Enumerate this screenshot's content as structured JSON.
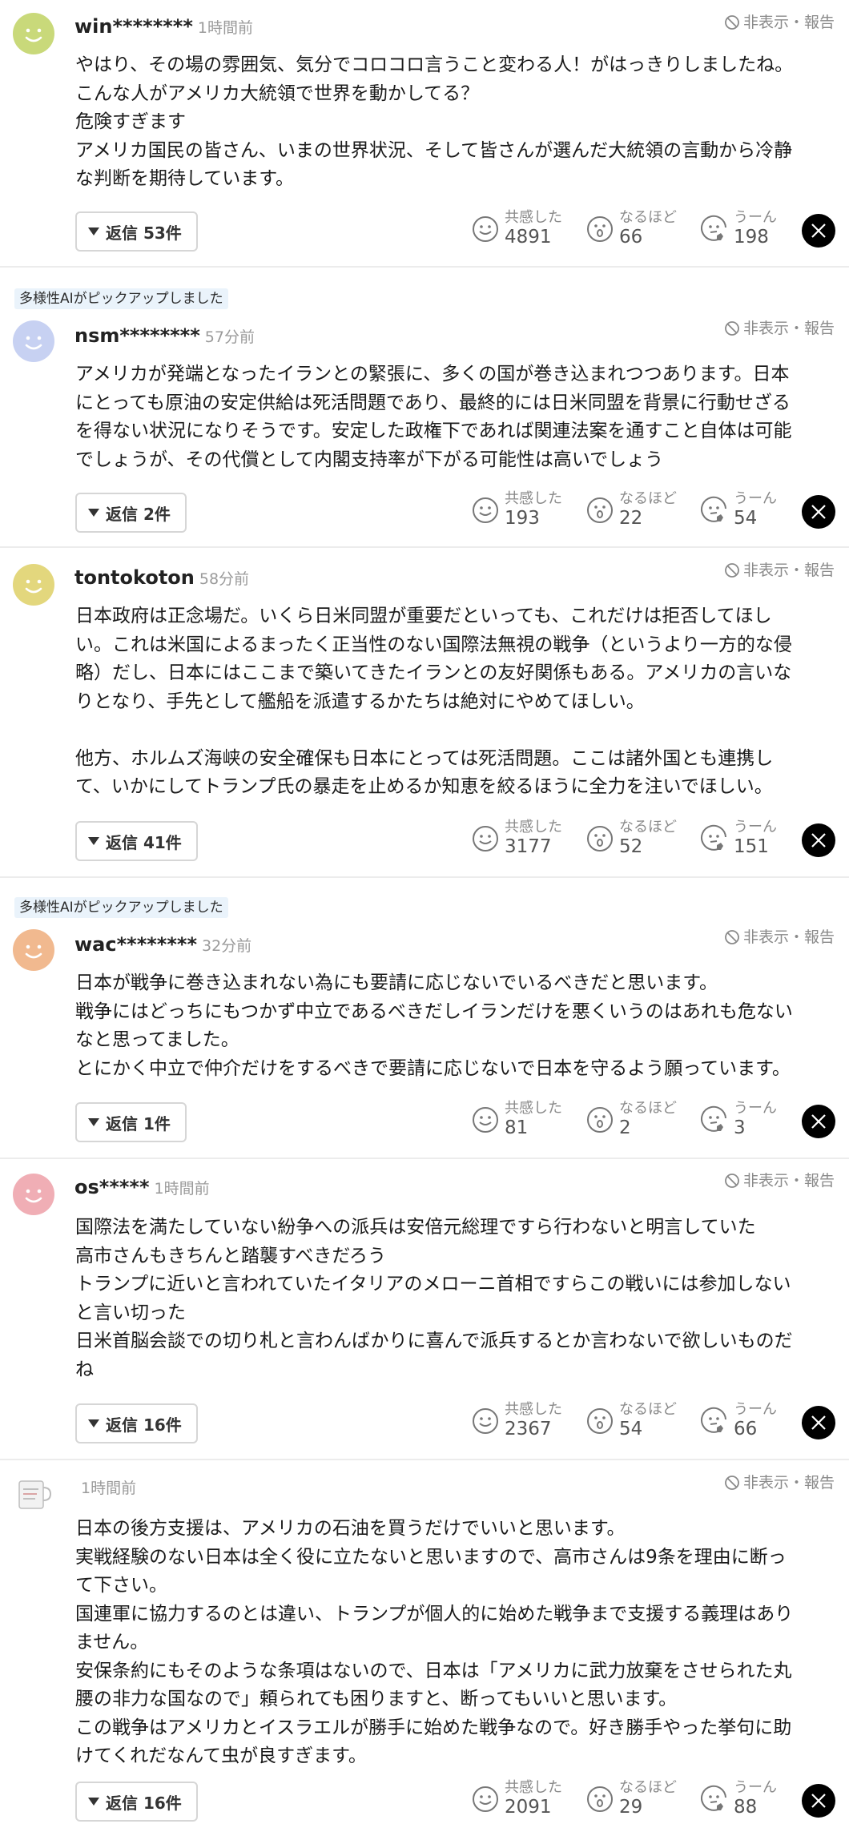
{
  "labels": {
    "hide_report": "非表示・報告",
    "empathy": "共感した",
    "insight": "なるほど",
    "hmm": "うーん",
    "ai_pick": "多様性AIがピックアップしました"
  },
  "colors": {
    "avatar_yellow_green": "#c9d97a",
    "avatar_blue": "#c7d1f2",
    "avatar_yellow": "#e3d77d",
    "avatar_orange": "#f1b98f",
    "avatar_pink": "#f0aeb5"
  },
  "comments": [
    {
      "user": "win********",
      "time": "1時間前",
      "ai_pick": false,
      "avatar_icon": "smiley-face-icon",
      "text": "やはり、その場の雰囲気、気分でコロコロ言うこと変わる人！がはっきりしましたね。\nこんな人がアメリカ大統領で世界を動かしてる？\n危険すぎます\nアメリカ国民の皆さん、いまの世界状況、そして皆さんが選んだ大統領の言動から冷静\nな判断を期待しています。",
      "reply_label": "返信 53件",
      "empathy_count": "4891",
      "insight_count": "66",
      "hmm_count": "198"
    },
    {
      "user": "nsm********",
      "time": "57分前",
      "ai_pick": true,
      "avatar_icon": "smiley-face-icon",
      "text": "アメリカが発端となったイランとの緊張に、多くの国が巻き込まれつつあります。日本\nにとっても原油の安定供給は死活問題であり、最終的には日米同盟を背景に行動せざる\nを得ない状況になりそうです。安定した政権下であれば関連法案を通すこと自体は可能\nでしょうが、その代償として内閣支持率が下がる可能性は高いでしょう",
      "reply_label": "返信 2件",
      "empathy_count": "193",
      "insight_count": "22",
      "hmm_count": "54"
    },
    {
      "user": "tontokoton",
      "time": "58分前",
      "ai_pick": false,
      "avatar_icon": "smiley-face-icon",
      "text": "日本政府は正念場だ。いくら日米同盟が重要だといっても、これだけは拒否してほし\nい。これは米国によるまったく正当性のない国際法無視の戦争（というより一方的な侵\n略）だし、日本にはここまで築いてきたイランとの友好関係もある。アメリカの言いな\nりとなり、手先として艦船を派遣するかたちは絶対にやめてほしい。\n\n他方、ホルムズ海峡の安全確保も日本にとっては死活問題。ここは諸外国とも連携し\nて、いかにしてトランプ氏の暴走を止めるか知恵を絞るほうに全力を注いでほしい。",
      "reply_label": "返信 41件",
      "empathy_count": "3177",
      "insight_count": "52",
      "hmm_count": "151"
    },
    {
      "user": "wac********",
      "time": "32分前",
      "ai_pick": true,
      "avatar_icon": "smiley-face-icon",
      "text": "日本が戦争に巻き込まれない為にも要請に応じないでいるべきだと思います。\n戦争にはどっちにもつかず中立であるべきだしイランだけを悪くいうのはあれも危ない\nなと思ってました。\nとにかく中立で仲介だけをするべきで要請に応じないで日本を守るよう願っています。",
      "reply_label": "返信 1件",
      "empathy_count": "81",
      "insight_count": "2",
      "hmm_count": "3"
    },
    {
      "user": "os*****",
      "time": "1時間前",
      "ai_pick": false,
      "avatar_icon": "smiley-face-icon",
      "text": "国際法を満たしていない紛争への派兵は安倍元総理ですら行わないと明言していた\n高市さんもきちんと踏襲すべきだろう\nトランプに近いと言われていたイタリアのメローニ首相ですらこの戦いには参加しない\nと言い切った\n日米首脳会談での切り札と言わんばかりに喜んで派兵するとか言わないで欲しいものだ\nね",
      "reply_label": "返信 16件",
      "empathy_count": "2367",
      "insight_count": "54",
      "hmm_count": "66"
    },
    {
      "user": "",
      "time": "1時間前",
      "ai_pick": false,
      "avatar_icon": "mug-photo-icon",
      "text": "日本の後方支援は、アメリカの石油を買うだけでいいと思います。\n実戦経験のない日本は全く役に立たないと思いますので、高市さんは9条を理由に断っ\nて下さい。\n国連軍に協力するのとは違い、トランプが個人的に始めた戦争まで支援する義理はあり\nません。\n安保条約にもそのような条項はないので、日本は「アメリカに武力放棄をさせられた丸\n腰の非力な国なので」頼られても困りますと、断ってもいいと思います。\nこの戦争はアメリカとイスラエルが勝手に始めた戦争なので。好き勝手やった挙句に助\nけてくれだなんて虫が良すぎます。",
      "reply_label": "返信 16件",
      "empathy_count": "2091",
      "insight_count": "29",
      "hmm_count": "88"
    }
  ]
}
